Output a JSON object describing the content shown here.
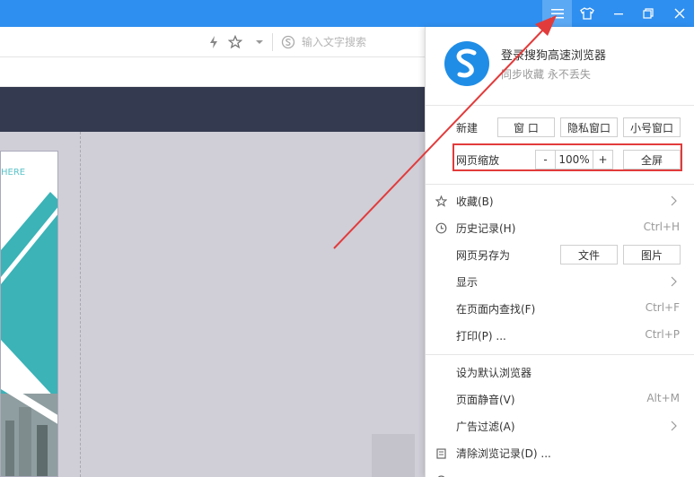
{
  "titlebar": {
    "menu_icon": "hamburger-icon",
    "skin_icon": "shirt-icon",
    "minimize_icon": "minimize-icon",
    "maximize_icon": "restore-icon",
    "close_icon": "close-icon",
    "color": "#2f8ff0"
  },
  "toolbar": {
    "search_placeholder": "输入文字搜索"
  },
  "page": {
    "card_text": "HERE"
  },
  "menu": {
    "login_title": "登录搜狗高速浏览器",
    "login_sub": "同步收藏 永不丢失",
    "new_label": "新建",
    "new_window": "窗 口",
    "new_private": "隐私窗口",
    "new_small": "小号窗口",
    "zoom_label": "网页缩放",
    "zoom_minus": "-",
    "zoom_value": "100%",
    "zoom_plus": "+",
    "fullscreen": "全屏",
    "items": [
      {
        "label": "收藏(B)",
        "shortcut": "",
        "icon": "star-icon",
        "arrow": true
      },
      {
        "label": "历史记录(H)",
        "shortcut": "Ctrl+H",
        "icon": "clock-icon",
        "arrow": false
      },
      {
        "label": "网页另存为",
        "shortcut": "",
        "icon": "",
        "arrow": false
      },
      {
        "label": "显示",
        "shortcut": "",
        "icon": "",
        "arrow": true
      },
      {
        "label": "在页面内查找(F)",
        "shortcut": "Ctrl+F",
        "icon": "",
        "arrow": false
      },
      {
        "label": "打印(P) ...",
        "shortcut": "Ctrl+P",
        "icon": "",
        "arrow": false
      },
      {
        "label": "设为默认浏览器",
        "shortcut": "",
        "icon": "",
        "arrow": false
      },
      {
        "label": "页面静音(V)",
        "shortcut": "Alt+M",
        "icon": "",
        "arrow": false
      },
      {
        "label": "广告过滤(A)",
        "shortcut": "",
        "icon": "",
        "arrow": true
      },
      {
        "label": "清除浏览记录(D) ...",
        "shortcut": "",
        "icon": "broom-icon",
        "arrow": false
      }
    ],
    "save_as_file": "文件",
    "save_as_image": "图片",
    "highlight_color": "#e23b3b"
  }
}
